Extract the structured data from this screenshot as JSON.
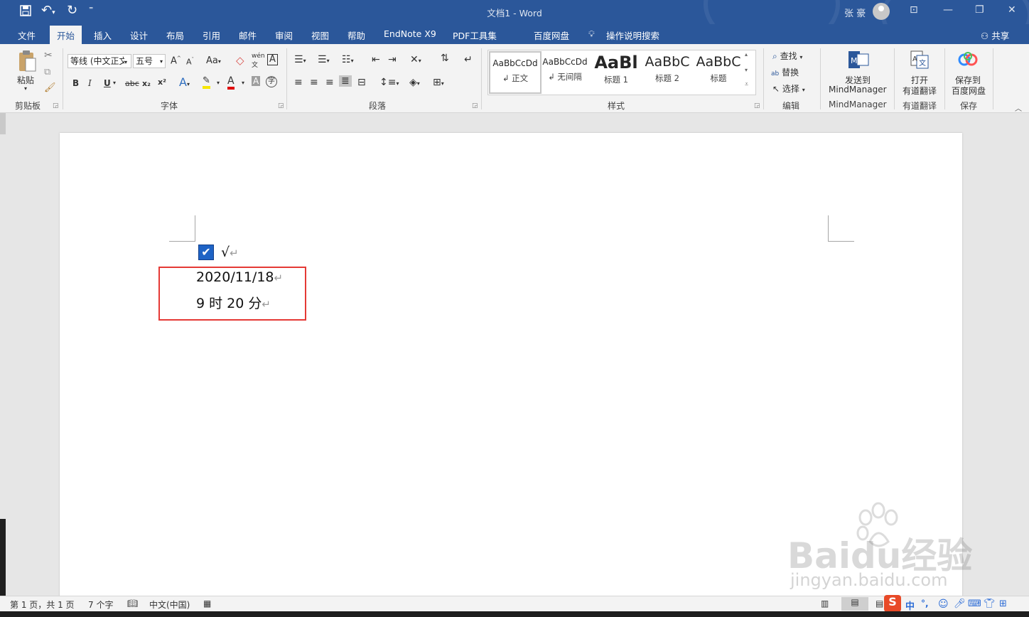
{
  "titlebar": {
    "doc_title": "文档1  -  Word",
    "user": "张 豪",
    "quick_access": [
      "save-icon",
      "undo-icon",
      "redo-icon",
      "customize-icon"
    ]
  },
  "tabs": [
    "文件",
    "开始",
    "插入",
    "设计",
    "布局",
    "引用",
    "邮件",
    "审阅",
    "视图",
    "帮助",
    "EndNote X9",
    "PDF工具集",
    "百度网盘"
  ],
  "active_tab": "开始",
  "tell_me": "操作说明搜索",
  "share": "共享",
  "ribbon": {
    "clipboard": {
      "paste": "粘贴",
      "label": "剪贴板"
    },
    "font": {
      "font_name": "等线 (中文正文)",
      "font_size": "五号",
      "label": "字体",
      "aa": "Aa",
      "bold": "B",
      "italic": "I",
      "underline": "U",
      "strike": "abc",
      "sub": "x₂",
      "sup": "x²",
      "grow": "A",
      "shrink": "A",
      "clear": "A",
      "wen": "wén",
      "border_a": "A",
      "color_a": "A",
      "shade_a": "A",
      "enclose": "字"
    },
    "paragraph": {
      "label": "段落"
    },
    "styles": {
      "label": "样式",
      "items": [
        {
          "sample": "AaBbCcDd",
          "name": "↲ 正文"
        },
        {
          "sample": "AaBbCcDd",
          "name": "↲ 无间隔"
        },
        {
          "sample": "AaBl",
          "name": "标题 1"
        },
        {
          "sample": "AaBbC",
          "name": "标题 2"
        },
        {
          "sample": "AaBbC",
          "name": "标题"
        }
      ]
    },
    "editing": {
      "find": "查找",
      "replace": "替换",
      "select": "选择",
      "label": "编辑"
    },
    "mindmanager": {
      "line1": "发送到",
      "line2": "MindManager",
      "label": "MindManager"
    },
    "youdao": {
      "line1": "打开",
      "line2": "有道翻译",
      "label": "有道翻译"
    },
    "baidu": {
      "line1": "保存到",
      "line2": "百度网盘",
      "label": "保存"
    }
  },
  "document": {
    "check_mark": "√",
    "line_date": "2020/11/18",
    "line_time": "9 时 20 分",
    "para_mark": "↵"
  },
  "statusbar": {
    "page": "第 1 页，共 1 页",
    "words": "7 个字",
    "language": "中文(中国)",
    "ime_mode": "中",
    "ime_punct": "°,"
  },
  "watermark": {
    "logo": "Baidu经验",
    "url": "jingyan.baidu.com"
  }
}
